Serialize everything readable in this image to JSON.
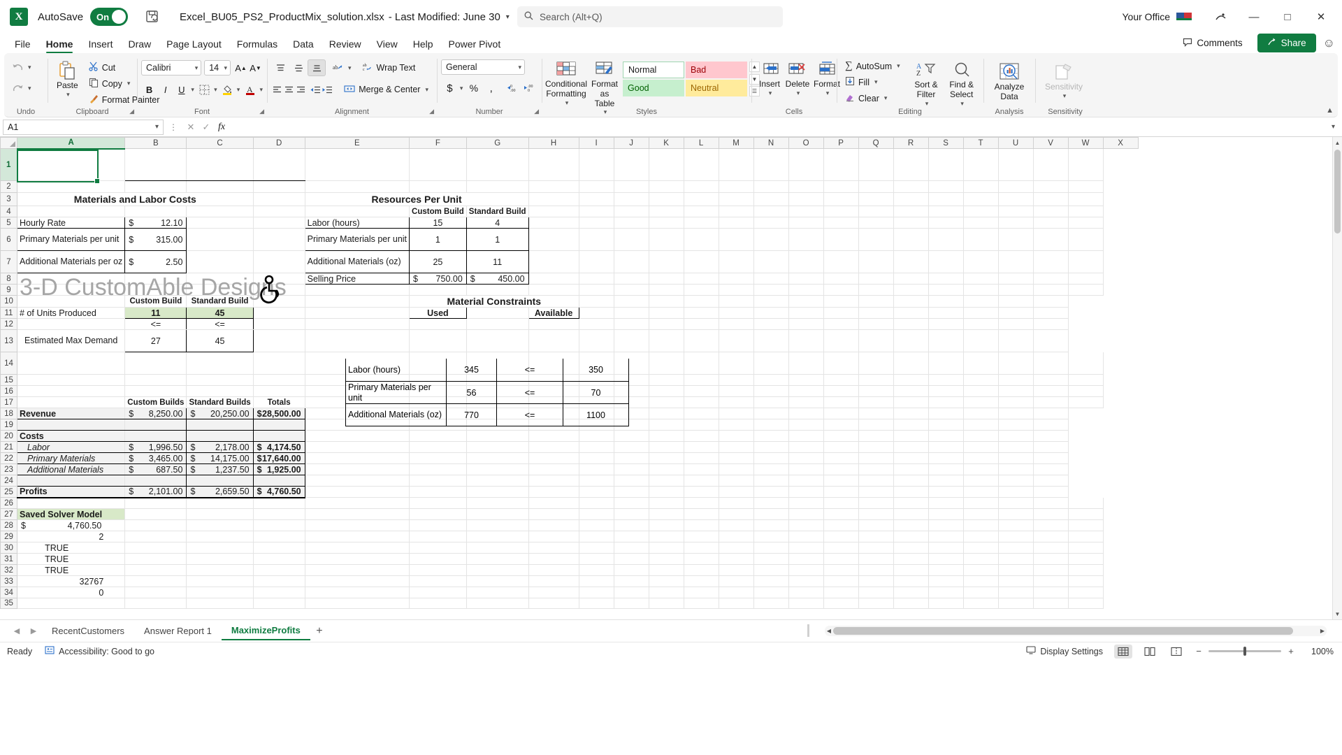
{
  "titlebar": {
    "autosave_label": "AutoSave",
    "autosave_state": "On",
    "document_name": "Excel_BU05_PS2_ProductMix_solution.xlsx",
    "last_modified": "-  Last Modified: June 30",
    "search_placeholder": "Search (Alt+Q)",
    "account_name": "Your Office",
    "minimize": "—",
    "maximize": "□",
    "close": "✕"
  },
  "ribbon": {
    "tabs": [
      "File",
      "Home",
      "Insert",
      "Draw",
      "Page Layout",
      "Formulas",
      "Data",
      "Review",
      "View",
      "Help",
      "Power Pivot"
    ],
    "active_tab": "Home",
    "comments_label": "Comments",
    "share_label": "Share",
    "groups": {
      "undo": {
        "label": "Undo"
      },
      "clipboard": {
        "label": "Clipboard",
        "paste": "Paste",
        "cut": "Cut",
        "copy": "Copy",
        "format_painter": "Format Painter"
      },
      "font": {
        "label": "Font",
        "font_name": "Calibri",
        "font_size": "14",
        "bold": "B",
        "italic": "I",
        "underline": "U"
      },
      "alignment": {
        "label": "Alignment",
        "wrap_text": "Wrap Text",
        "merge_center": "Merge & Center"
      },
      "number": {
        "label": "Number",
        "format": "General"
      },
      "styles": {
        "label": "Styles",
        "conditional_formatting": "Conditional Formatting",
        "format_as_table": "Format as Table",
        "cell_styles": [
          "Normal",
          "Bad",
          "Good",
          "Neutral"
        ]
      },
      "cells": {
        "label": "Cells",
        "insert": "Insert",
        "delete": "Delete",
        "format": "Format"
      },
      "editing": {
        "label": "Editing",
        "autosum": "AutoSum",
        "fill": "Fill",
        "clear": "Clear",
        "sort_filter": "Sort & Filter",
        "find_select": "Find & Select"
      },
      "analysis": {
        "label": "Analysis",
        "analyze_data": "Analyze Data"
      },
      "sensitivity": {
        "label": "Sensitivity",
        "sensitivity": "Sensitivity"
      }
    }
  },
  "formula_bar": {
    "name_box": "A1",
    "formula": ""
  },
  "grid": {
    "column_headers": [
      "A",
      "B",
      "C",
      "D",
      "E",
      "F",
      "G",
      "H",
      "I",
      "J",
      "K",
      "L",
      "M",
      "N",
      "O",
      "P",
      "Q",
      "R",
      "S",
      "T",
      "U",
      "V",
      "W",
      "X"
    ],
    "active_cell": "A1",
    "sheet_title": "3-D CustomAble Designs",
    "rows": [
      {
        "n": "1"
      },
      {
        "n": "2"
      },
      {
        "n": "3"
      },
      {
        "n": "4"
      },
      {
        "n": "5"
      },
      {
        "n": "6"
      },
      {
        "n": "7"
      },
      {
        "n": "8"
      },
      {
        "n": "9"
      },
      {
        "n": "10"
      },
      {
        "n": "11"
      },
      {
        "n": "12"
      },
      {
        "n": "13"
      },
      {
        "n": "14"
      },
      {
        "n": "15"
      },
      {
        "n": "16"
      },
      {
        "n": "17"
      },
      {
        "n": "18"
      },
      {
        "n": "19"
      },
      {
        "n": "20"
      },
      {
        "n": "21"
      },
      {
        "n": "22"
      },
      {
        "n": "23"
      },
      {
        "n": "24"
      },
      {
        "n": "25"
      },
      {
        "n": "26"
      },
      {
        "n": "27"
      },
      {
        "n": "28"
      },
      {
        "n": "29"
      },
      {
        "n": "30"
      },
      {
        "n": "31"
      },
      {
        "n": "32"
      },
      {
        "n": "33"
      },
      {
        "n": "34"
      },
      {
        "n": "35"
      }
    ]
  },
  "sheet": {
    "materials_labor": {
      "title": "Materials and Labor Costs",
      "rows": [
        {
          "label": "Hourly Rate",
          "cur": "$",
          "value": "12.10"
        },
        {
          "label": "Primary Materials per unit",
          "cur": "$",
          "value": "315.00"
        },
        {
          "label": "Additional Materials per oz",
          "cur": "$",
          "value": "2.50"
        }
      ]
    },
    "resources_per_unit": {
      "title": "Resources Per Unit",
      "col_custom": "Custom Build",
      "col_standard": "Standard Build",
      "rows": [
        {
          "label": "Labor (hours)",
          "custom": "15",
          "standard": "4"
        },
        {
          "label": "Primary Materials per unit",
          "custom": "1",
          "standard": "1"
        },
        {
          "label": "Additional Materials (oz)",
          "custom": "25",
          "standard": "11"
        },
        {
          "label": "Selling Price",
          "cur": "$",
          "custom": "750.00",
          "cur2": "$",
          "standard": "450.00"
        }
      ]
    },
    "units": {
      "col_custom": "Custom Build",
      "col_standard": "Standard Build",
      "produced_label": "# of Units Produced",
      "produced_custom": "11",
      "produced_standard": "45",
      "op": "<=",
      "demand_label": "Estimated Max Demand",
      "demand_custom": "27",
      "demand_standard": "45"
    },
    "material_constraints": {
      "title": "Material Constraints",
      "col_used": "Used",
      "col_available": "Available",
      "rows": [
        {
          "label": "Labor (hours)",
          "used": "345",
          "op": "<=",
          "available": "350"
        },
        {
          "label": "Primary Materials per unit",
          "used": "56",
          "op": "<=",
          "available": "70"
        },
        {
          "label": "Additional Materials (oz)",
          "used": "770",
          "op": "<=",
          "available": "1100"
        }
      ]
    },
    "financials": {
      "col_custom": "Custom Builds",
      "col_standard": "Standard Builds",
      "col_totals": "Totals",
      "revenue": {
        "label": "Revenue",
        "custom": "8,250.00",
        "standard": "20,250.00",
        "total": "28,500.00",
        "cur": "$"
      },
      "costs_label": "Costs",
      "costs": [
        {
          "label": "Labor",
          "custom": "1,996.50",
          "standard": "2,178.00",
          "total": "4,174.50",
          "cur": "$"
        },
        {
          "label": "Primary Materials",
          "custom": "3,465.00",
          "standard": "14,175.00",
          "total": "17,640.00",
          "cur": "$"
        },
        {
          "label": "Additional Materials",
          "custom": "687.50",
          "standard": "1,237.50",
          "total": "1,925.00",
          "cur": "$"
        }
      ],
      "profits": {
        "label": "Profits",
        "custom": "2,101.00",
        "standard": "2,659.50",
        "total": "4,760.50",
        "cur": "$"
      }
    },
    "solver": {
      "title": "Saved Solver Model",
      "rows": [
        {
          "cur": "$",
          "value": "4,760.50"
        },
        {
          "value": "2"
        },
        {
          "value": "TRUE"
        },
        {
          "value": "TRUE"
        },
        {
          "value": "TRUE"
        },
        {
          "value": "32767"
        },
        {
          "value": "0"
        }
      ]
    }
  },
  "sheet_tabs": {
    "tabs": [
      "RecentCustomers",
      "Answer Report 1",
      "MaximizeProfits"
    ],
    "active": "MaximizeProfits",
    "add_label": "+"
  },
  "statusbar": {
    "ready": "Ready",
    "accessibility": "Accessibility: Good to go",
    "display_settings": "Display Settings",
    "zoom": "100%",
    "zoom_out": "−",
    "zoom_in": "+"
  }
}
